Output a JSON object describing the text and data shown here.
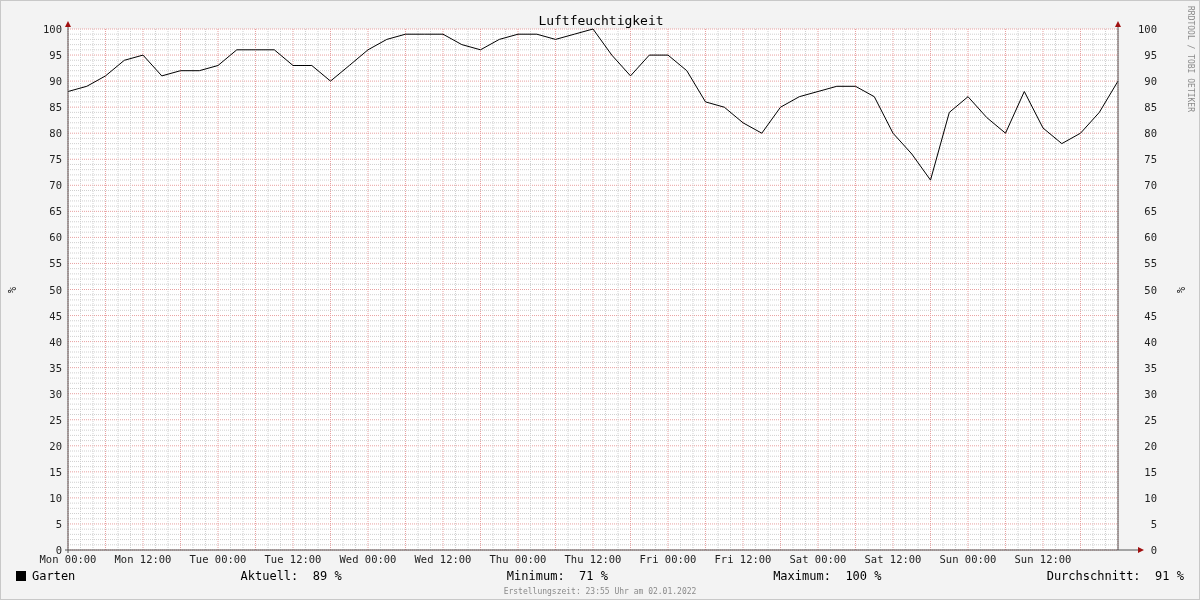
{
  "graph": {
    "chart_data": {
      "type": "line",
      "title": "Luftfeuchtigkeit",
      "ylabel": "%",
      "categories": [
        "Mon 00:00",
        null,
        null,
        null,
        "Mon 12:00",
        null,
        null,
        null,
        "Tue 00:00",
        null,
        null,
        null,
        "Tue 12:00",
        null,
        null,
        null,
        "Wed 00:00",
        null,
        null,
        null,
        "Wed 12:00",
        null,
        null,
        null,
        "Thu 00:00",
        null,
        null,
        null,
        "Thu 12:00",
        null,
        null,
        null,
        "Fri 00:00",
        null,
        null,
        null,
        "Fri 12:00",
        null,
        null,
        null,
        "Sat 00:00",
        null,
        null,
        null,
        "Sat 12:00",
        null,
        null,
        null,
        "Sun 00:00",
        null,
        null,
        null,
        "Sun 12:00",
        null,
        null,
        null,
        null
      ],
      "series": [
        {
          "name": "Garten",
          "color": "#000000",
          "values": [
            88,
            89,
            91,
            94,
            95,
            91,
            92,
            92,
            93,
            96,
            96,
            96,
            93,
            93,
            90,
            93,
            96,
            98,
            99,
            99,
            99,
            97,
            96,
            98,
            99,
            99,
            98,
            99,
            100,
            95,
            91,
            95,
            95,
            92,
            86,
            85,
            82,
            80,
            85,
            87,
            88,
            89,
            89,
            87,
            80,
            76,
            71,
            84,
            87,
            83,
            80,
            88,
            81,
            78,
            80,
            84,
            90
          ]
        }
      ],
      "ylim": [
        0,
        100
      ],
      "grid": true,
      "yticks": [
        0,
        5,
        10,
        15,
        20,
        25,
        30,
        35,
        40,
        45,
        50,
        55,
        60,
        65,
        70,
        75,
        80,
        85,
        90,
        95,
        100
      ]
    },
    "right_axis": {
      "label": "%",
      "ticks": [
        "100",
        "95",
        "90",
        "85",
        "80",
        "75",
        "70",
        "65",
        "60",
        "55",
        "50",
        "45",
        "40",
        "35",
        "30",
        "25",
        "20",
        "15",
        "10",
        "5",
        "0"
      ]
    },
    "watermark": "RRDTOOL / TOBI OETIKER"
  },
  "legend": {
    "stats": [
      {
        "label": "Aktuell:",
        "value": "89 %"
      },
      {
        "label": "Minimum:",
        "value": "71 %"
      },
      {
        "label": "Maximum:",
        "value": "100 %"
      },
      {
        "label": "Durchschnitt:",
        "value": "91 %"
      }
    ]
  },
  "footer": "Erstellungszeit: 23:55 Uhr am 02.01.2022"
}
